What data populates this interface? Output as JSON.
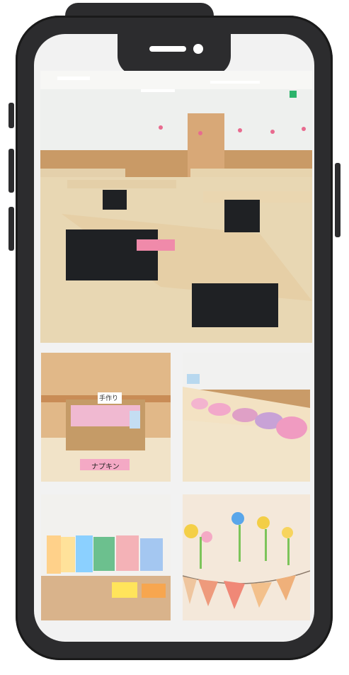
{
  "photos": {
    "main": {
      "semantic": "seminar-room-photo"
    },
    "napkins": {
      "label_sign_top": "手作り",
      "label_tag": "ナプキン"
    },
    "dolls": {
      "semantic": "baby-doll-table-photo"
    },
    "books": {
      "semantic": "picture-book-shelf-photo"
    },
    "decor": {
      "semantic": "wall-decoration-photo"
    }
  },
  "colors": {
    "phone_body": "#2c2c2e",
    "screen_bg": "#f2f2f2",
    "wood": "#d7b48a",
    "wall": "#f4f1ea"
  }
}
